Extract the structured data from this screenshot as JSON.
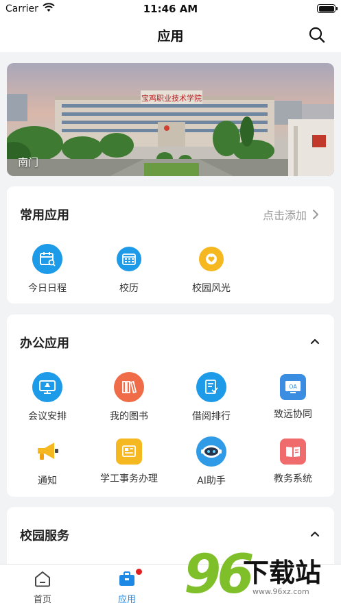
{
  "status_bar": {
    "carrier": "Carrier",
    "time": "11:46 AM"
  },
  "nav": {
    "title": "应用",
    "search_icon": "search-icon"
  },
  "banner": {
    "caption": "南门",
    "image_desc": "campus-photo",
    "sign_text": "宝鸡职业技术学院"
  },
  "common_apps": {
    "title": "常用应用",
    "action_label": "点击添加",
    "items": [
      {
        "label": "今日日程",
        "icon": "schedule-icon",
        "color": "#1e9be8"
      },
      {
        "label": "校历",
        "icon": "calendar-icon",
        "color": "#1e9be8"
      },
      {
        "label": "校园风光",
        "icon": "heart-badge-icon",
        "color": "#f5b820"
      }
    ]
  },
  "office_apps": {
    "title": "办公应用",
    "items": [
      {
        "label": "会议安排",
        "icon": "meeting-icon",
        "color": "#1e9be8"
      },
      {
        "label": "我的图书",
        "icon": "books-icon",
        "color": "#f06b47"
      },
      {
        "label": "借阅排行",
        "icon": "ranking-icon",
        "color": "#1e9be8"
      },
      {
        "label": "致远协同",
        "icon": "oa-icon",
        "color": "#3a8de0"
      },
      {
        "label": "通知",
        "icon": "megaphone-icon",
        "color": "#f5b820"
      },
      {
        "label": "学工事务办理",
        "icon": "affairs-icon",
        "color": "#f5b820"
      },
      {
        "label": "AI助手",
        "icon": "robot-icon",
        "color": "#2f9ae6"
      },
      {
        "label": "教务系统",
        "icon": "academic-book-icon",
        "color": "#f06b6b"
      }
    ]
  },
  "campus_services": {
    "title": "校园服务"
  },
  "tab_bar": {
    "items": [
      {
        "label": "首页",
        "icon": "home-icon",
        "active": false
      },
      {
        "label": "应用",
        "icon": "apps-briefcase-icon",
        "active": true
      }
    ],
    "active_color": "#1e88e5",
    "badge_color": "#e02020"
  },
  "watermark": {
    "logo": "96",
    "text": "下载站",
    "url": "www.96xz.com"
  }
}
